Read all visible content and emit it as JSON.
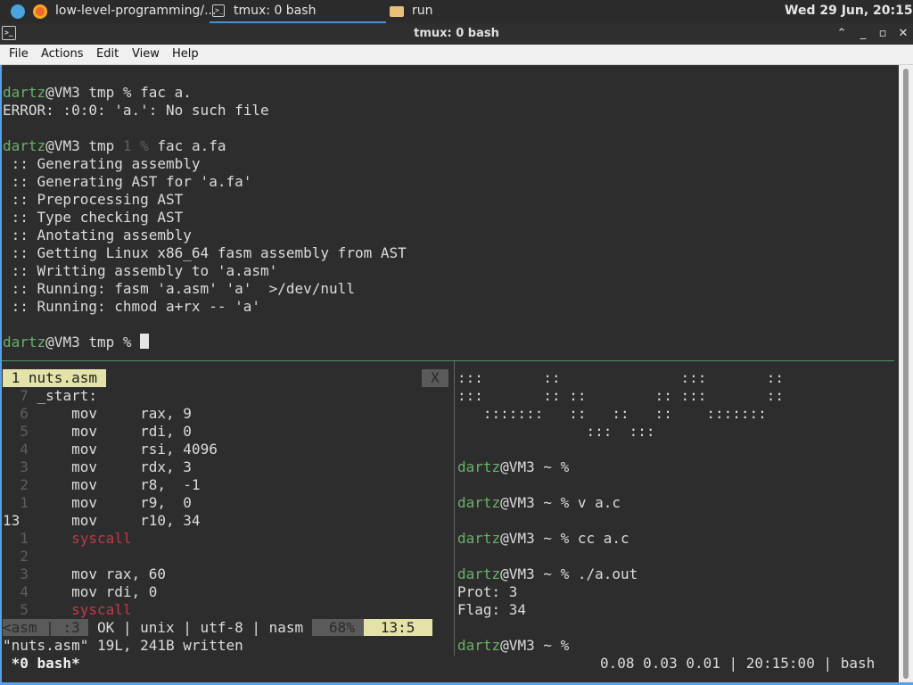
{
  "topbar": {
    "browser_tab": "low-level-programming/...",
    "terminal_tab": "tmux: 0 bash",
    "folder_tab": "run",
    "clock": "Wed 29 Jun, 20:15"
  },
  "window": {
    "title": "tmux: 0 bash"
  },
  "menu": [
    "File",
    "Actions",
    "Edit",
    "View",
    "Help"
  ],
  "top_pane": {
    "cmd1": {
      "user": "dartz",
      "host": "@VM3 tmp % ",
      "command": "fac a."
    },
    "error": "ERROR: :0:0: 'a.': No such file",
    "cmd2": {
      "user": "dartz",
      "host": "@VM3 tmp ",
      "status": "1 %",
      "command": " fac a.fa"
    },
    "output": [
      " :: Generating assembly",
      " :: Generating AST for 'a.fa'",
      " :: Preprocessing AST",
      " :: Type checking AST",
      " :: Anotating assembly",
      " :: Getting Linux x86_64 fasm assembly from AST",
      " :: Writting assembly to 'a.asm'",
      " :: Running: fasm 'a.asm' 'a'  >/dev/null",
      " :: Running: chmod a+rx -- 'a'"
    ],
    "prompt": {
      "user": "dartz",
      "host": "@VM3 tmp % "
    }
  },
  "editor": {
    "tab": " 1 nuts.asm ",
    "close": "X",
    "lines": [
      {
        "num": "  7",
        "text": " _start:",
        "red": false
      },
      {
        "num": "  6",
        "text": "     mov     rax, 9",
        "red": false
      },
      {
        "num": "  5",
        "text": "     mov     rdi, 0",
        "red": false
      },
      {
        "num": "  4",
        "text": "     mov     rsi, 4096",
        "red": false
      },
      {
        "num": "  3",
        "text": "     mov     rdx, 3",
        "red": false
      },
      {
        "num": "  2",
        "text": "     mov     r8,  -1",
        "red": false
      },
      {
        "num": "  1",
        "text": "     mov     r9,  0",
        "red": false
      },
      {
        "num": "13 ",
        "text": "     mov     r10, 34",
        "red": false
      },
      {
        "num": "  1",
        "text": "     syscall",
        "red": true
      },
      {
        "num": "  2",
        "text": "",
        "red": false
      },
      {
        "num": "  3",
        "text": "     mov rax, 60",
        "red": false
      },
      {
        "num": "  4",
        "text": "     mov rdi, 0",
        "red": false
      },
      {
        "num": "  5",
        "text": "     syscall",
        "red": true
      }
    ],
    "status": {
      "mode": "<asm",
      "col": " | :3 ",
      "info": " OK | unix | utf-8 | nasm ",
      "percent": "  68% ",
      "position": "  13:5  "
    },
    "message": "\"nuts.asm\" 19L, 241B written"
  },
  "right_pane": {
    "art": [
      ":::       ::              :::       ::",
      ":::       :: ::        :: :::       ::",
      "   :::::::   ::   ::   ::    :::::::",
      "               :::  :::"
    ],
    "commands": [
      {
        "user": "dartz",
        "host": "@VM3 ~ % ",
        "command": ""
      },
      {
        "user": "dartz",
        "host": "@VM3 ~ % ",
        "command": "v a.c"
      },
      {
        "user": "dartz",
        "host": "@VM3 ~ % ",
        "command": "cc a.c"
      },
      {
        "user": "dartz",
        "host": "@VM3 ~ % ",
        "command": "./a.out"
      }
    ],
    "output": [
      "Prot: 3",
      "Flag: 34"
    ],
    "prompt": {
      "user": "dartz",
      "host": "@VM3 ~ % "
    }
  },
  "tmux_status": {
    "window": " *0 bash*",
    "right": "0.08 0.03 0.01 | 20:15:00 | bash"
  },
  "colors": {
    "prompt_user": "#6ab06a",
    "syscall": "#c0394a",
    "tab_active_bg": "#e2e2a9",
    "selection_accent": "#5aa0e6"
  }
}
